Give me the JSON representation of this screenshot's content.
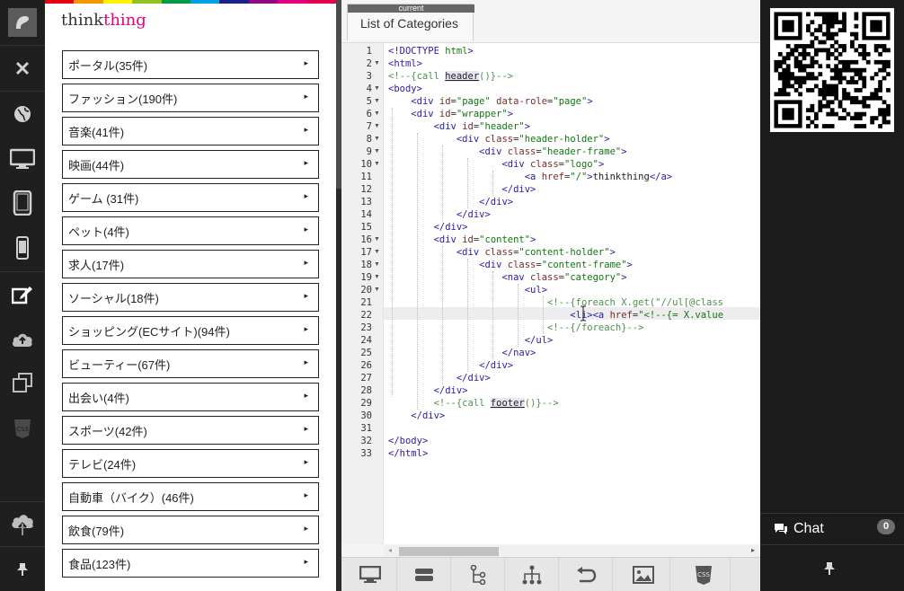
{
  "preview": {
    "brand_part1": "think",
    "brand_part2": "thing",
    "brand_colors": [
      "#333333",
      "#e3007f"
    ],
    "rainbow_colors": [
      "#e60012",
      "#f39800",
      "#fff100",
      "#8fc31f",
      "#009944",
      "#00a0e9",
      "#1d2088",
      "#920783",
      "#e4007f",
      "#e5004f"
    ],
    "categories": [
      "ポータル(35件)",
      "ファッション(190件)",
      "音楽(41件)",
      "映画(44件)",
      "ゲーム (31件)",
      "ペット(4件)",
      "求人(17件)",
      "ソーシャル(18件)",
      "ショッピング(ECサイト)(94件)",
      "ビューティー(67件)",
      "出会い(4件)",
      "スポーツ(42件)",
      "テレビ(24件)",
      "自動車（バイク）(46件)",
      "飲食(79件)",
      "食品(123件)"
    ],
    "arrow": "▸"
  },
  "toolbar": {
    "icons": [
      "app-logo-icon",
      "close-icon",
      "globe-icon",
      "desktop-icon",
      "tablet-icon",
      "phone-icon",
      "edit-icon",
      "upload-cloud-icon",
      "copy-icon",
      "css-icon",
      "cloud-upload-icon",
      "pin-icon"
    ],
    "css_label": "CSS"
  },
  "editor": {
    "tab_badge": "current",
    "tab_title": "List of Categories",
    "line_numbers": [
      "1",
      "2",
      "3",
      "4",
      "5",
      "6",
      "7",
      "8",
      "9",
      "10",
      "11",
      "12",
      "13",
      "14",
      "15",
      "16",
      "17",
      "18",
      "19",
      "20",
      "21",
      "22",
      "23",
      "24",
      "25",
      "26",
      "27",
      "28",
      "29",
      "30",
      "31",
      "32",
      "33"
    ],
    "lines": [
      "<!DOCTYPE html>",
      "<html>",
      "<!--{call header()}-->",
      "<body>",
      "    <div id=\"page\" data-role=\"page\">",
      "    <div id=\"wrapper\">",
      "        <div id=\"header\">",
      "            <div class=\"header-holder\">",
      "                <div class=\"header-frame\">",
      "                    <div class=\"logo\">",
      "                        <a href=\"/\">thinkthing</a>",
      "                    </div>",
      "                </div>",
      "            </div>",
      "        </div>",
      "        <div id=\"content\">",
      "            <div class=\"content-holder\">",
      "                <div class=\"content-frame\">",
      "                    <nav class=\"category\">",
      "                        <ul>",
      "                            <!--{foreach X.get(\"//ul[@class",
      "                                <li><a href=\"<!--{= X.value",
      "                            <!--{/foreach}-->",
      "                        </ul>",
      "                    </nav>",
      "                </div>",
      "            </div>",
      "        </div>",
      "        <!--{call footer()}-->",
      "    </div>",
      "",
      "</body>",
      "</html>"
    ],
    "bottom_tools": [
      "desktop-view-icon",
      "layout-icon",
      "tree-icon",
      "sitemap-icon",
      "undo-icon",
      "image-icon",
      "css-file-icon"
    ],
    "bottom_css_label": "CSS"
  },
  "right": {
    "chat_label": "Chat",
    "chat_count": "0"
  }
}
